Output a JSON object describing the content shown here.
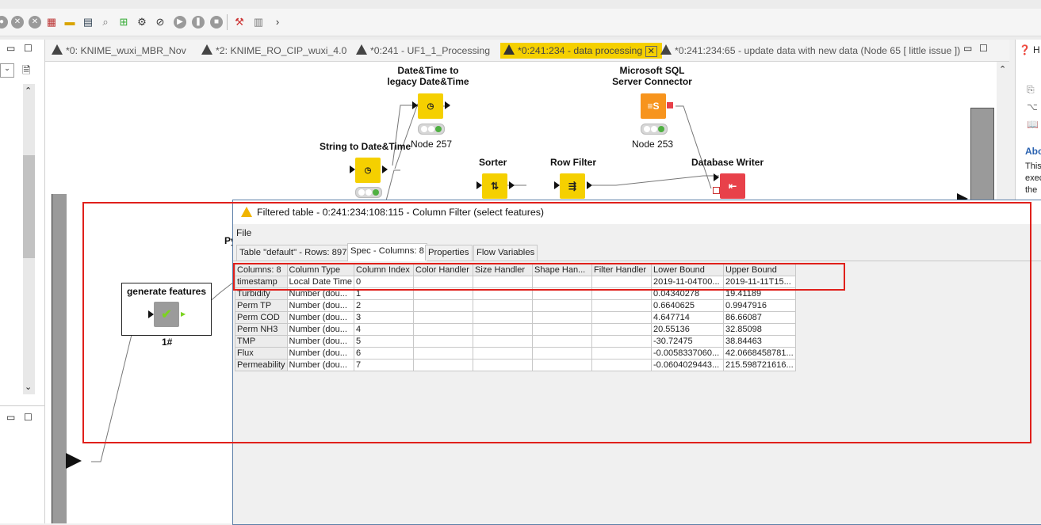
{
  "tabs": [
    {
      "label": "*0: KNIME_wuxi_MBR_Nov"
    },
    {
      "label": "*2: KNIME_RO_CIP_wuxi_4.0"
    },
    {
      "label": "*0:241 - UF1_1_Processing"
    },
    {
      "label": "*0:241:234 - data processing",
      "active": true
    },
    {
      "label": "*0:241:234:65 - update data with new data (Node 65 [ little issue ])"
    }
  ],
  "workflow": {
    "nodes": {
      "dt_legacy": {
        "title_line1": "Date&Time to",
        "title_line2": "legacy Date&Time",
        "name": "Node 257"
      },
      "str_to_dt": {
        "title": "String to Date&Time"
      },
      "mssql": {
        "title_line1": "Microsoft SQL",
        "title_line2": "Server Connector",
        "name": "Node 253"
      },
      "sorter": {
        "title": "Sorter"
      },
      "row_filter": {
        "title": "Row Filter"
      },
      "db_writer": {
        "title": "Database Writer"
      },
      "gen_features": {
        "title": "generate features",
        "name": "1#"
      },
      "partial_label": "Py"
    }
  },
  "dialog": {
    "title": "Filtered table - 0:241:234:108:115 - Column Filter (select features)",
    "menu_file": "File",
    "tabs": [
      "Table \"default\" - Rows: 897",
      "Spec - Columns: 8",
      "Properties",
      "Flow Variables"
    ],
    "selected_tab": 1,
    "columns": [
      "Columns: 8",
      "Column Type",
      "Column Index",
      "Color Handler",
      "Size Handler",
      "Shape Han...",
      "Filter Handler",
      "Lower Bound",
      "Upper Bound"
    ],
    "rows": [
      [
        "timestamp",
        "Local Date Time",
        "0",
        "",
        "",
        "",
        "",
        "2019-11-04T00...",
        "2019-11-11T15..."
      ],
      [
        "Turbidity",
        "Number (dou...",
        "1",
        "",
        "",
        "",
        "",
        "0.04340278",
        "19.41189"
      ],
      [
        "Perm TP",
        "Number (dou...",
        "2",
        "",
        "",
        "",
        "",
        "0.6640625",
        "0.9947916"
      ],
      [
        "Perm COD",
        "Number (dou...",
        "3",
        "",
        "",
        "",
        "",
        "4.647714",
        "86.66087"
      ],
      [
        "Perm NH3",
        "Number (dou...",
        "4",
        "",
        "",
        "",
        "",
        "20.55136",
        "32.85098"
      ],
      [
        "TMP",
        "Number (dou...",
        "5",
        "",
        "",
        "",
        "",
        "-30.72475",
        "38.84463"
      ],
      [
        "Flux",
        "Number (dou...",
        "6",
        "",
        "",
        "",
        "",
        "-0.0058337060...",
        "42.0668458781..."
      ],
      [
        "Permeability",
        "Number (dou...",
        "7",
        "",
        "",
        "",
        "",
        "-0.0604029443...",
        "215.598721616..."
      ]
    ]
  },
  "right_panel": {
    "h_label": "H",
    "about": "Abo",
    "text_lines": [
      "This",
      "exec",
      "the"
    ]
  },
  "colors": {
    "accent_tab": "#f5d000",
    "highlight_box": "#e0201b",
    "executed_green": "#4fb042"
  }
}
